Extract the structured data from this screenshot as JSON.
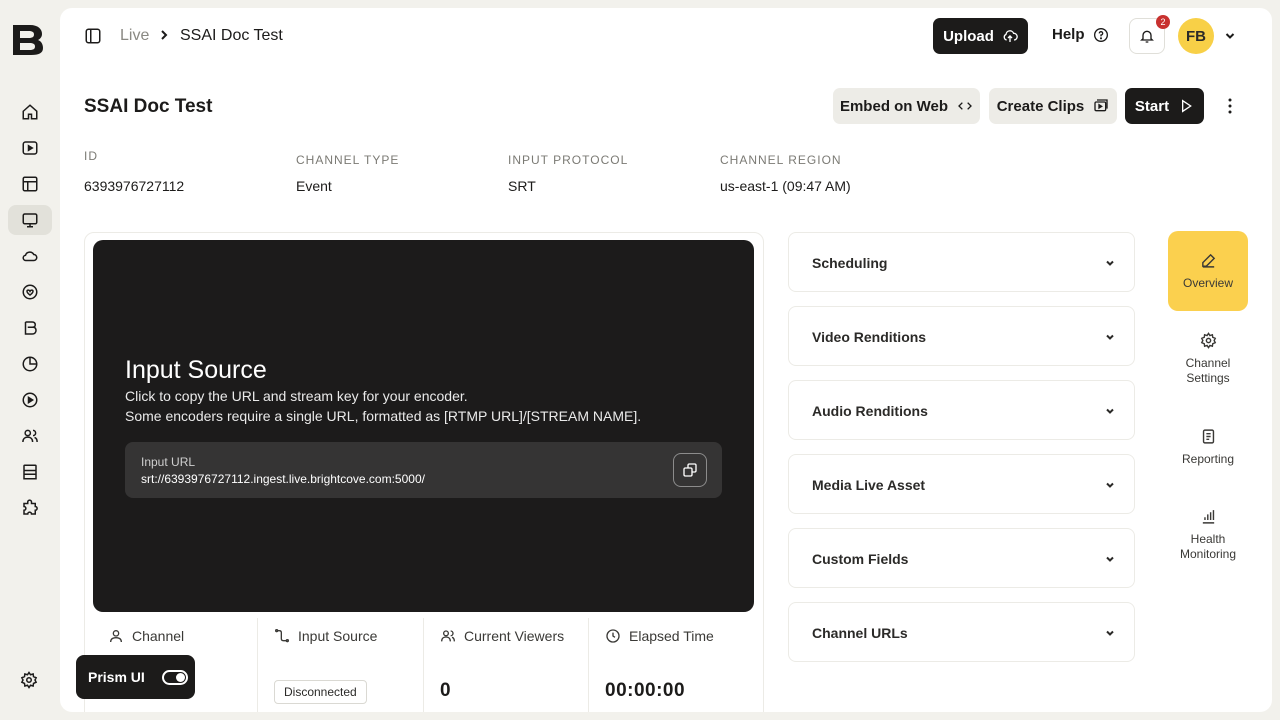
{
  "breadcrumb": {
    "parent": "Live",
    "current": "SSAI Doc Test"
  },
  "header": {
    "upload_label": "Upload",
    "help_label": "Help",
    "notification_count": "2",
    "user_initials": "FB"
  },
  "page": {
    "title": "SSAI Doc Test",
    "actions": {
      "embed": "Embed on Web",
      "clips": "Create Clips",
      "start": "Start"
    }
  },
  "meta": {
    "id_label": "ID",
    "id_value": "6393976727112",
    "type_label": "CHANNEL TYPE",
    "type_value": "Event",
    "protocol_label": "INPUT PROTOCOL",
    "protocol_value": "SRT",
    "region_label": "CHANNEL REGION",
    "region_value": "us-east-1 (09:47 AM)"
  },
  "player": {
    "title": "Input Source",
    "desc1": "Click to copy the URL and stream key for your encoder.",
    "desc2": "Some encoders require a single URL, formatted as [RTMP URL]/[STREAM NAME].",
    "url_label": "Input URL",
    "url_value": "srt://6393976727112.ingest.live.brightcove.com:5000/"
  },
  "stats": {
    "channel": "Channel",
    "input_source": "Input Source",
    "input_status": "Disconnected",
    "viewers": "Current Viewers",
    "viewers_value": "0",
    "elapsed": "Elapsed Time",
    "elapsed_value": "00:00:00"
  },
  "accordions": [
    "Scheduling",
    "Video Renditions",
    "Audio Renditions",
    "Media Live Asset",
    "Custom Fields",
    "Channel URLs"
  ],
  "side_tabs": {
    "overview": "Overview",
    "settings_1": "Channel",
    "settings_2": "Settings",
    "reporting": "Reporting",
    "health_1": "Health",
    "health_2": "Monitoring"
  },
  "prism": {
    "label": "Prism UI"
  },
  "colors": {
    "accent": "#fbd04e",
    "dark": "#1c1b1a",
    "badge": "#c8312f"
  }
}
